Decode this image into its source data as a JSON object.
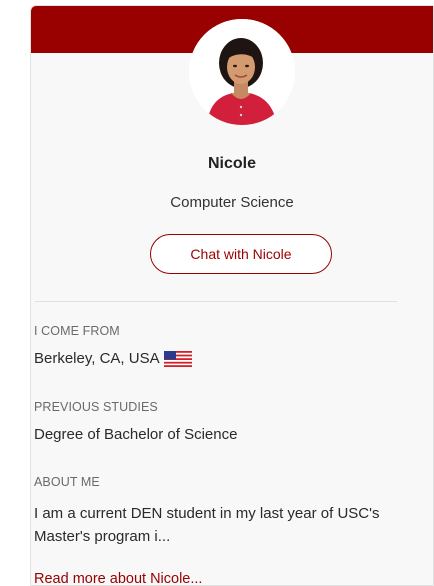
{
  "profile": {
    "name": "Nicole",
    "major": "Computer Science",
    "chat_label": "Chat with Nicole"
  },
  "details": {
    "from_label": "I COME FROM",
    "from_value": "Berkeley, CA, USA",
    "from_flag_icon": "us-flag-icon",
    "studies_label": "PREVIOUS STUDIES",
    "studies_value": "Degree of Bachelor of Science",
    "about_label": "ABOUT ME",
    "about_text": "I am a current DEN student in my last year of USC's Master's program i...",
    "read_more_label": "Read more about Nicole..."
  },
  "colors": {
    "brand": "#990000",
    "card_background": "#f8f8f8"
  }
}
